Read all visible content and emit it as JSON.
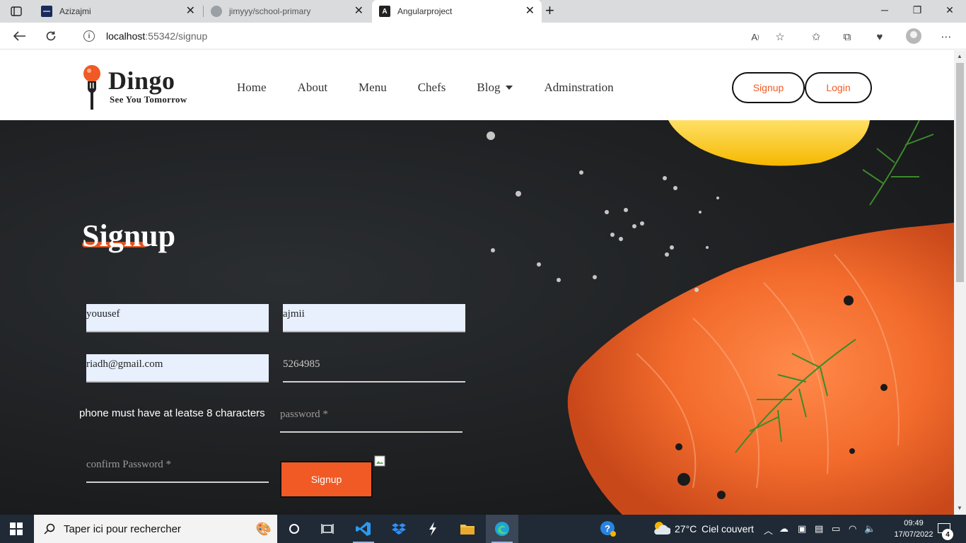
{
  "browser": {
    "tabs": [
      {
        "title": "Azizajmi",
        "favicon": "site-favicon"
      },
      {
        "title": "jimyyy/school-primary",
        "favicon": "github-icon"
      },
      {
        "title": "Angularproject",
        "favicon": "angular-icon"
      }
    ],
    "url_host": "localhost",
    "url_rest": ":55342/signup"
  },
  "site": {
    "logo_name": "Dingo",
    "tagline": "See You Tomorrow",
    "nav": [
      "Home",
      "About",
      "Menu",
      "Chefs",
      "Blog",
      "Adminstration"
    ],
    "signup_label": "Signup",
    "login_label": "Login"
  },
  "form": {
    "title": "Signup",
    "first_name": "youusef",
    "last_name": "ajmii",
    "email": "riadh@gmail.com",
    "phone": "5264985",
    "phone_error": "phone must have at leatse 8 characters",
    "password_placeholder": "password *",
    "confirm_placeholder": "confirm Password *",
    "submit_label": "Signup"
  },
  "taskbar": {
    "search_placeholder": "Taper ici pour rechercher",
    "weather_temp": "27°C",
    "weather_desc": "Ciel couvert",
    "time": "09:49",
    "date": "17/07/2022",
    "notification_count": "4"
  },
  "colors": {
    "accent": "#f15a24",
    "hero_bg": "#1d1f21",
    "taskbar_bg": "#1f2a36"
  }
}
